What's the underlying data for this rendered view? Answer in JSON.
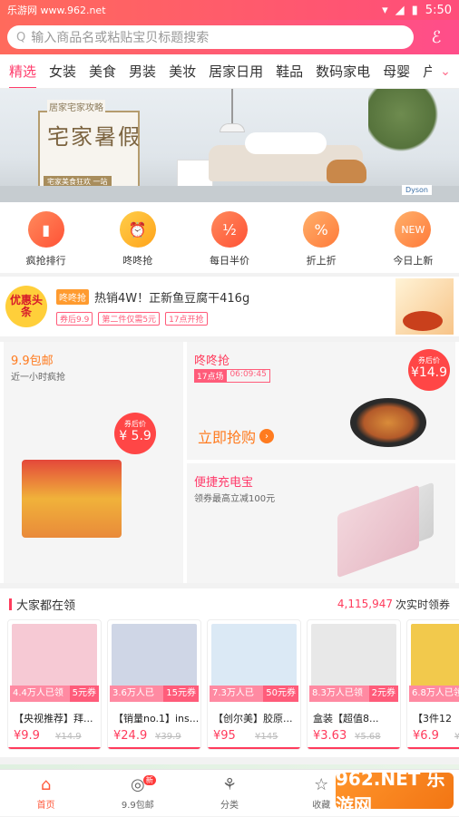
{
  "status": {
    "left": "乐游网 www.962.net",
    "time": "5:50"
  },
  "search": {
    "placeholder": "输入商品名或粘贴宝贝标题搜索"
  },
  "tabs": [
    "精选",
    "女装",
    "美食",
    "男装",
    "美妆",
    "居家日用",
    "鞋品",
    "数码家电",
    "母婴",
    "户"
  ],
  "banner": {
    "sub1": "居家宅家攻略",
    "big": "宅家暑假",
    "sub2": "宅家美食狂欢 一站",
    "tag": "Dyson"
  },
  "quick": [
    {
      "label": "疯抢排行",
      "icon": "▮"
    },
    {
      "label": "咚咚抢",
      "icon": "⏰"
    },
    {
      "label": "每日半价",
      "icon": "½"
    },
    {
      "label": "折上折",
      "icon": "%"
    },
    {
      "label": "今日上新",
      "icon": "NEW"
    }
  ],
  "news": {
    "logo": "优惠头条",
    "pill": "咚咚抢",
    "title": "热销4W！正新鱼豆腐干416g",
    "tags": [
      "券后9.9",
      "第二件仅需5元",
      "17点开抢"
    ]
  },
  "deals": {
    "left": {
      "title": "9.9包邮",
      "sub": "近一小时疯抢",
      "coupon_label": "券后价",
      "coupon_value": "¥ 5.9"
    },
    "right1": {
      "title": "咚咚抢",
      "time_a": "17点场",
      "time_b": "06:09:45",
      "grab": "立即抢购",
      "coupon_label": "券后价",
      "coupon_value": "¥14.9"
    },
    "right2": {
      "title": "便捷充电宝",
      "sub": "领券最高立减100元"
    }
  },
  "popular": {
    "title": "大家都在领",
    "count": "4,115,947",
    "suffix": "次实时领券",
    "items": [
      {
        "sold": "4.4万人已领",
        "coupon": "5元券",
        "name": "【央视推荐】拜...",
        "price": "¥9.9",
        "orig": "¥14.9",
        "color": "#f6c9d4"
      },
      {
        "sold": "3.6万人已领",
        "coupon": "15元券",
        "name": "【销量no.1】ins...",
        "price": "¥24.9",
        "orig": "¥39.9",
        "color": "#cfd6e6"
      },
      {
        "sold": "7.3万人已领",
        "coupon": "50元券",
        "name": "【创尔美】胶原...",
        "price": "¥95",
        "orig": "¥145",
        "color": "#dbe9f5"
      },
      {
        "sold": "8.3万人已领",
        "coupon": "2元券",
        "name": "盒装【超值8...",
        "price": "¥3.63",
        "orig": "¥5.68",
        "color": "#e8e8e8"
      },
      {
        "sold": "6.8万人已领",
        "coupon": "",
        "name": "【3件12",
        "price": "¥6.9",
        "orig": "¥1",
        "color": "#f2c94c"
      }
    ]
  },
  "tabbar": [
    {
      "label": "首页",
      "icon": "⌂"
    },
    {
      "label": "9.9包邮",
      "icon": "◎",
      "badge": "新"
    },
    {
      "label": "分类",
      "icon": "⚘"
    },
    {
      "label": "收藏",
      "icon": "☆"
    }
  ],
  "watermark": "962.NET 乐游网"
}
